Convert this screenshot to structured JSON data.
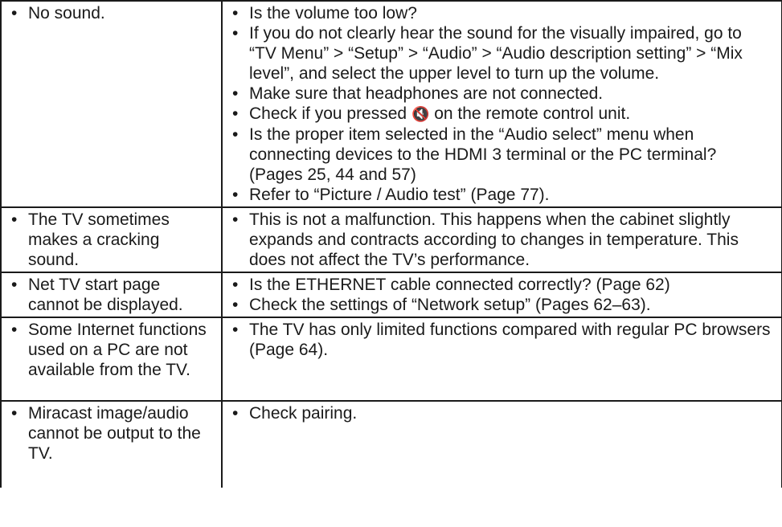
{
  "rows": [
    {
      "problem": [
        "No sound."
      ],
      "solutions": [
        "Is the volume too low?",
        "If you do not clearly hear the sound for the visually impaired, go to “TV Menu” > “Setup” > “Audio” > “Audio description setting” > “Mix level”, and select the upper level to turn up the volume.",
        "Make sure that headphones are not connected.",
        {
          "before": "Check if you pressed ",
          "icon": "🔇",
          "after": " on the remote control unit."
        },
        "Is the proper item selected in the “Audio select” menu when connecting devices to the HDMI 3 terminal or the PC terminal? (Pages 25, 44 and 57)",
        "Refer to “Picture / Audio test” (Page 77)."
      ]
    },
    {
      "problem": [
        "The TV sometimes makes a cracking sound."
      ],
      "solutions": [
        "This is not a malfunction. This happens when the cabinet slightly expands and contracts according to changes in temperature. This does not affect the TV’s performance."
      ]
    },
    {
      "problem": [
        "Net TV start page cannot be displayed."
      ],
      "solutions": [
        "Is the ETHERNET cable connected correctly? (Page 62)",
        "Check the settings of “Network setup” (Pages 62–63)."
      ]
    },
    {
      "problem": [
        "Some Internet functions used on a PC are not available from the TV."
      ],
      "solutions": [
        "The TV has only limited functions compared with regular PC browsers (Page 64)."
      ]
    },
    {
      "problem": [
        "Miracast image/audio cannot be output to the TV."
      ],
      "solutions": [
        "Check pairing."
      ]
    }
  ],
  "icons": {
    "mute": "mute-icon"
  }
}
